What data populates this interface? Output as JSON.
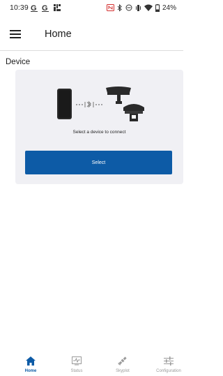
{
  "status_bar": {
    "time": "10:39",
    "battery": "24%",
    "left_icons": [
      "g-icon",
      "g-icon",
      "notification-icon"
    ],
    "right_icons": [
      "nfc-icon",
      "bluetooth-icon",
      "do-not-disturb-icon",
      "vibrate-icon",
      "wifi-icon",
      "battery-icon"
    ]
  },
  "app_bar": {
    "title": "Home"
  },
  "device": {
    "section_title": "Device",
    "connect_message": "Select a device to connect",
    "select_label": "Select"
  },
  "bottom_nav": {
    "items": [
      {
        "label": "Home",
        "icon": "home-icon",
        "active": true
      },
      {
        "label": "Status",
        "icon": "status-icon",
        "active": false
      },
      {
        "label": "Skyplot",
        "icon": "satellite-icon",
        "active": false
      },
      {
        "label": "Configuration",
        "icon": "sliders-icon",
        "active": false
      }
    ]
  },
  "colors": {
    "accent": "#0d5ba6",
    "card_bg": "#f0f0f4",
    "inactive": "#9a9a9a"
  }
}
